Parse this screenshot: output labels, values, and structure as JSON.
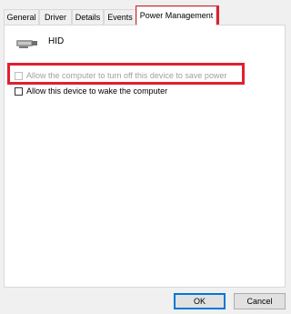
{
  "tabs": [
    {
      "label": "General"
    },
    {
      "label": "Driver"
    },
    {
      "label": "Details"
    },
    {
      "label": "Events"
    },
    {
      "label": "Power Management"
    }
  ],
  "active_tab": "Power Management",
  "device": {
    "name": "HID",
    "icon": "hid-device-icon"
  },
  "options": [
    {
      "label": "Allow the computer to turn off this device to save power",
      "checked": false,
      "enabled": false
    },
    {
      "label": "Allow this device to wake the computer",
      "checked": false,
      "enabled": true
    }
  ],
  "buttons": {
    "ok": "OK",
    "cancel": "Cancel"
  },
  "colors": {
    "highlight": "#e0202e",
    "default_button_border": "#0078d7"
  }
}
